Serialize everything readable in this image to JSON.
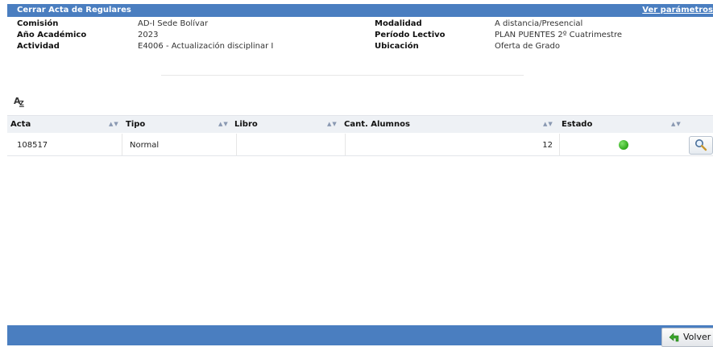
{
  "header": {
    "title": "Cerrar Acta de Regulares",
    "params_link": "Ver parámetros"
  },
  "info": {
    "left": [
      {
        "label": "Comisión",
        "value": "AD-I Sede Bolívar"
      },
      {
        "label": "Año Académico",
        "value": "2023"
      },
      {
        "label": "Actividad",
        "value": "E4006 - Actualización disciplinar I"
      }
    ],
    "right": [
      {
        "label": "Modalidad",
        "value": "A distancia/Presencial"
      },
      {
        "label": "Período Lectivo",
        "value": "PLAN PUENTES 2º Cuatrimestre"
      },
      {
        "label": "Ubicación",
        "value": "Oferta de Grado"
      }
    ]
  },
  "table": {
    "columns": [
      "Acta",
      "Tipo",
      "Libro",
      "Cant. Alumnos",
      "Estado"
    ],
    "rows": [
      {
        "acta": "108517",
        "tipo": "Normal",
        "libro": "",
        "cant_alumnos": "12",
        "estado": "green"
      }
    ]
  },
  "icons": {
    "sort_az": "sort-az-icon",
    "search": "magnifier-icon",
    "back": "green-arrow-icon"
  },
  "colors": {
    "header_bg": "#4a7ec0",
    "status_ok": "#2ea81a"
  },
  "footer": {
    "volver_label": "Volver"
  }
}
